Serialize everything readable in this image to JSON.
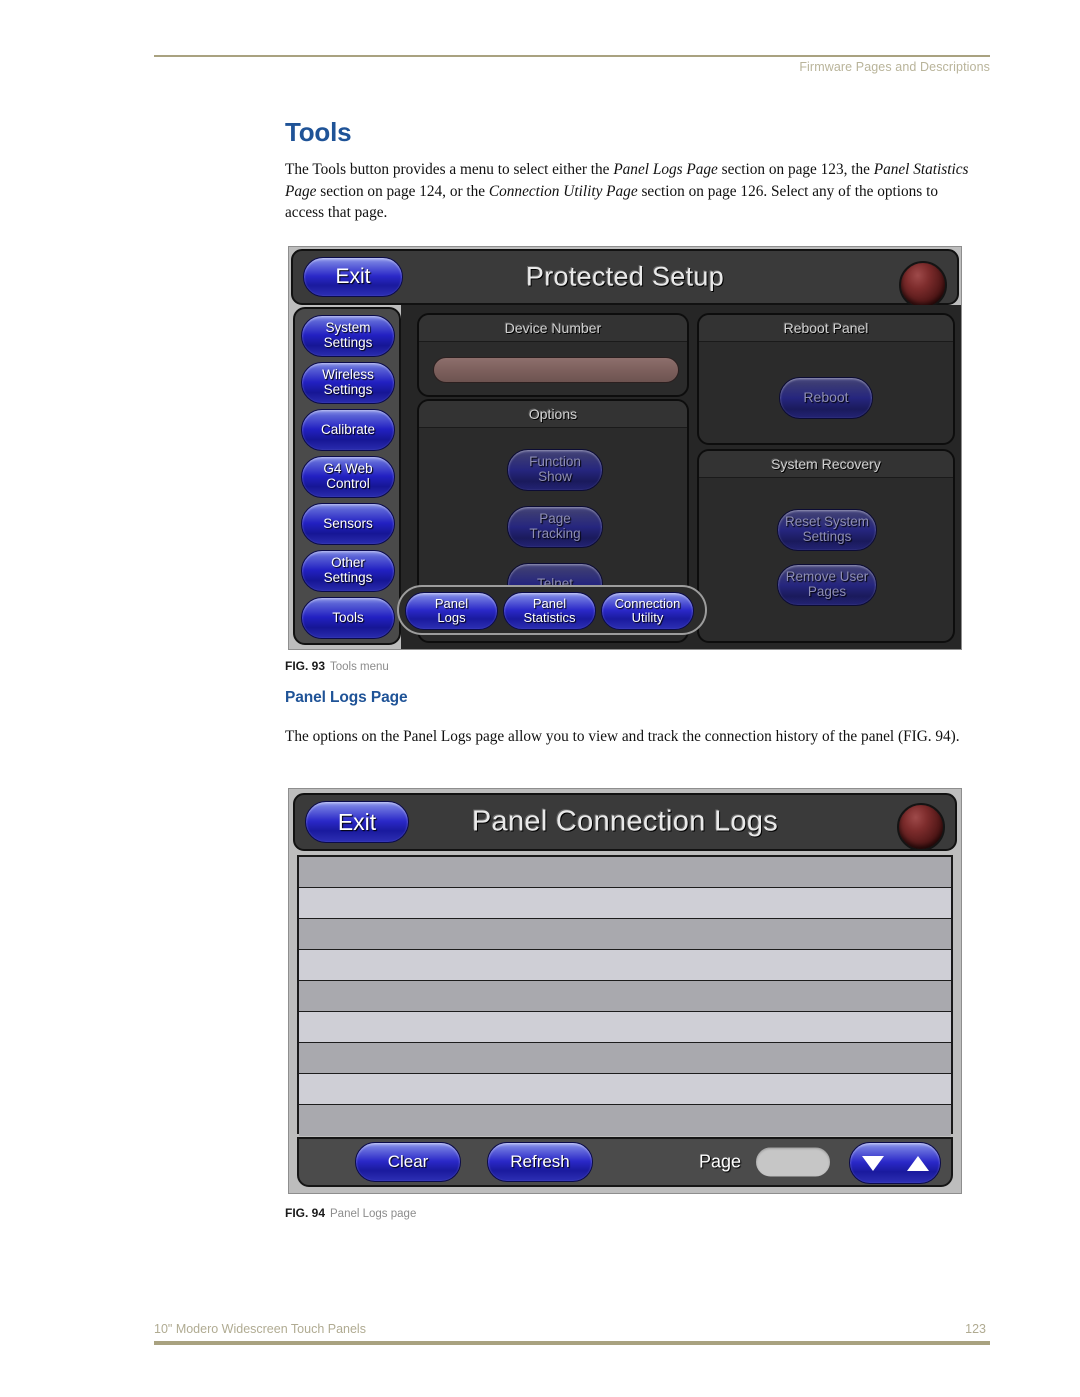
{
  "header": {
    "running_head": "Firmware Pages and Descriptions"
  },
  "section": {
    "title": "Tools",
    "paragraph_1": {
      "t1": "The Tools button provides a menu to select either the ",
      "i1": "Panel Logs Page",
      "t2": " section on page 123, the ",
      "i2": "Panel Statistics Page",
      "t3": " section on page 124, or the ",
      "i3": "Connection Utility Page",
      "t4": " section on page 126. Select any of the options to access that page."
    }
  },
  "subsection": {
    "title": "Panel Logs Page",
    "paragraph_1": "The options on the Panel Logs page allow you to view and track the connection history of the panel (FIG. 94)."
  },
  "figure_93": {
    "caption_number": "FIG. 93",
    "caption_text": "Tools menu",
    "screen_title": "Protected Setup",
    "exit_label": "Exit",
    "sidebar": [
      {
        "label_1": "System",
        "label_2": "Settings"
      },
      {
        "label_1": "Wireless",
        "label_2": "Settings"
      },
      {
        "label_1": "Calibrate",
        "label_2": ""
      },
      {
        "label_1": "G4 Web",
        "label_2": "Control"
      },
      {
        "label_1": "Sensors",
        "label_2": ""
      },
      {
        "label_1": "Other",
        "label_2": "Settings"
      },
      {
        "label_1": "Tools",
        "label_2": ""
      }
    ],
    "device_number": {
      "title": "Device Number",
      "value": ""
    },
    "options": {
      "title": "Options",
      "buttons": [
        {
          "label_1": "Function",
          "label_2": "Show"
        },
        {
          "label_1": "Page",
          "label_2": "Tracking"
        },
        {
          "label_1": "Telnet",
          "label_2": ""
        }
      ]
    },
    "reboot_panel": {
      "title": "Reboot Panel",
      "button": "Reboot"
    },
    "system_recovery": {
      "title": "System Recovery",
      "buttons": [
        {
          "label_1": "Reset System",
          "label_2": "Settings"
        },
        {
          "label_1": "Remove User",
          "label_2": "Pages"
        }
      ]
    },
    "tools_popup": [
      {
        "label_1": "Panel",
        "label_2": "Logs"
      },
      {
        "label_1": "Panel",
        "label_2": "Statistics"
      },
      {
        "label_1": "Connection",
        "label_2": "Utility"
      }
    ]
  },
  "figure_94": {
    "caption_number": "FIG. 94",
    "caption_text": "Panel Logs page",
    "screen_title": "Panel Connection Logs",
    "exit_label": "Exit",
    "log_rows": [
      "",
      "",
      "",
      "",
      "",
      "",
      "",
      "",
      ""
    ],
    "clear_label": "Clear",
    "refresh_label": "Refresh",
    "page_label": "Page",
    "page_value": ""
  },
  "footer": {
    "document_title": "10\" Modero Widescreen Touch Panels",
    "page_number": "123"
  },
  "colors": {
    "heading_blue": "#1f5397",
    "rule_tan": "#a9a280",
    "button_blue": "#2a28c8",
    "led_red": "#7d2c2c",
    "device_field": "#7d605d"
  }
}
